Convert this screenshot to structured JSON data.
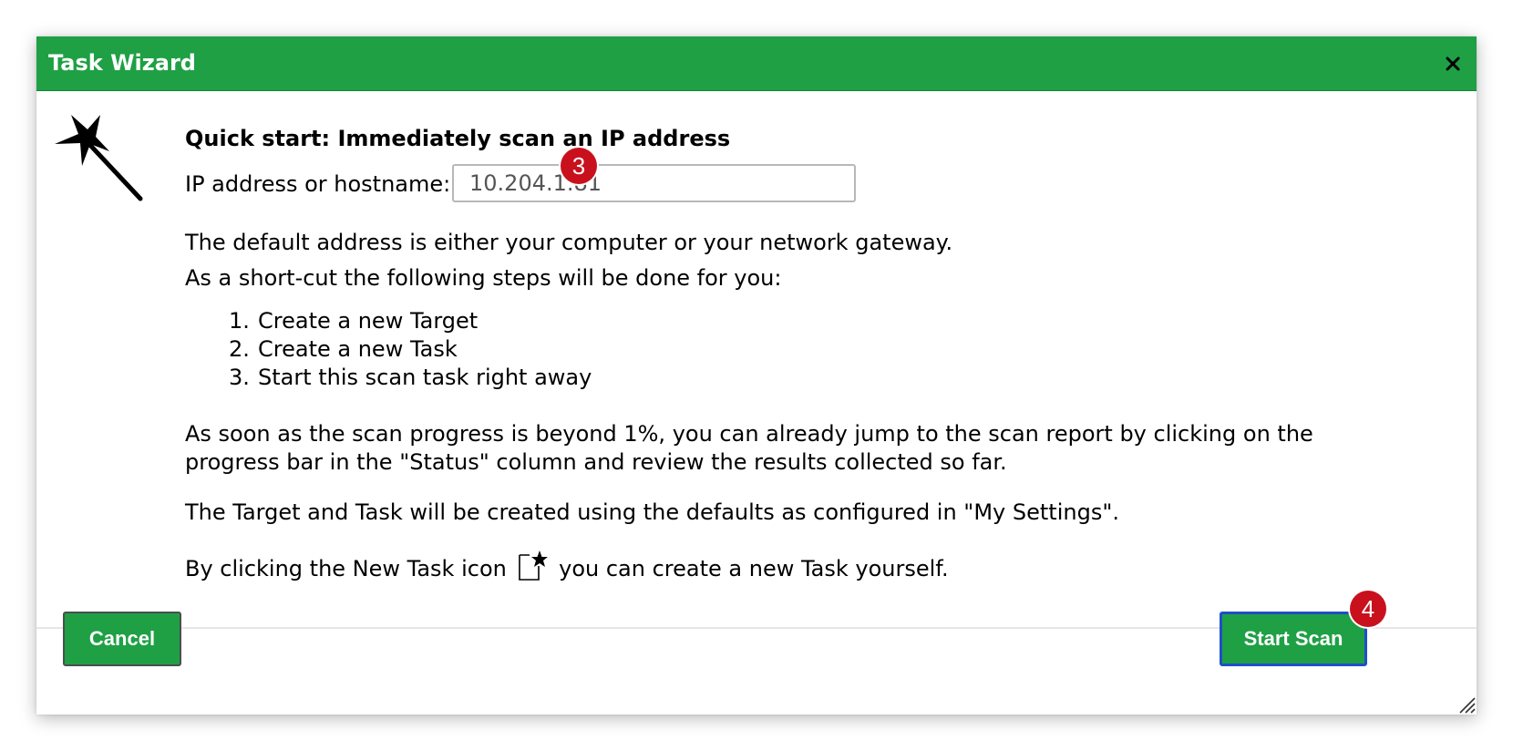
{
  "dialog": {
    "title": "Task Wizard",
    "close_icon": "close-icon",
    "heading": "Quick start: Immediately scan an IP address",
    "ip_label": "IP address or hostname:",
    "ip_value": "10.204.1.81",
    "default_note": "The default address is either your computer or your network gateway.",
    "shortcut_note": "As a short-cut the following steps will be done for you:",
    "steps": [
      {
        "num": "1.",
        "label": "Create a new Target"
      },
      {
        "num": "2.",
        "label": "Create a new Task"
      },
      {
        "num": "3.",
        "label": "Start this scan task right away"
      }
    ],
    "progress_note": "As soon as the scan progress is beyond 1%, you can already jump to the scan report by clicking on the progress bar in the \"Status\" column and review the results collected so far.",
    "defaults_note": "The Target and Task will be created using the defaults as configured in \"My Settings\".",
    "new_task_prefix": "By clicking the New Task icon",
    "new_task_suffix": "you can create a new Task yourself.",
    "cancel_label": "Cancel",
    "start_label": "Start Scan"
  },
  "annotations": {
    "badge_ip": "3",
    "badge_start": "4"
  },
  "colors": {
    "accent": "#1fa045",
    "focus": "#1e4fc8",
    "badge": "#c8111d"
  },
  "icons": {
    "wizard": "magic-wand-icon",
    "new_task": "new-task-icon",
    "resize": "resize-grip-icon"
  }
}
